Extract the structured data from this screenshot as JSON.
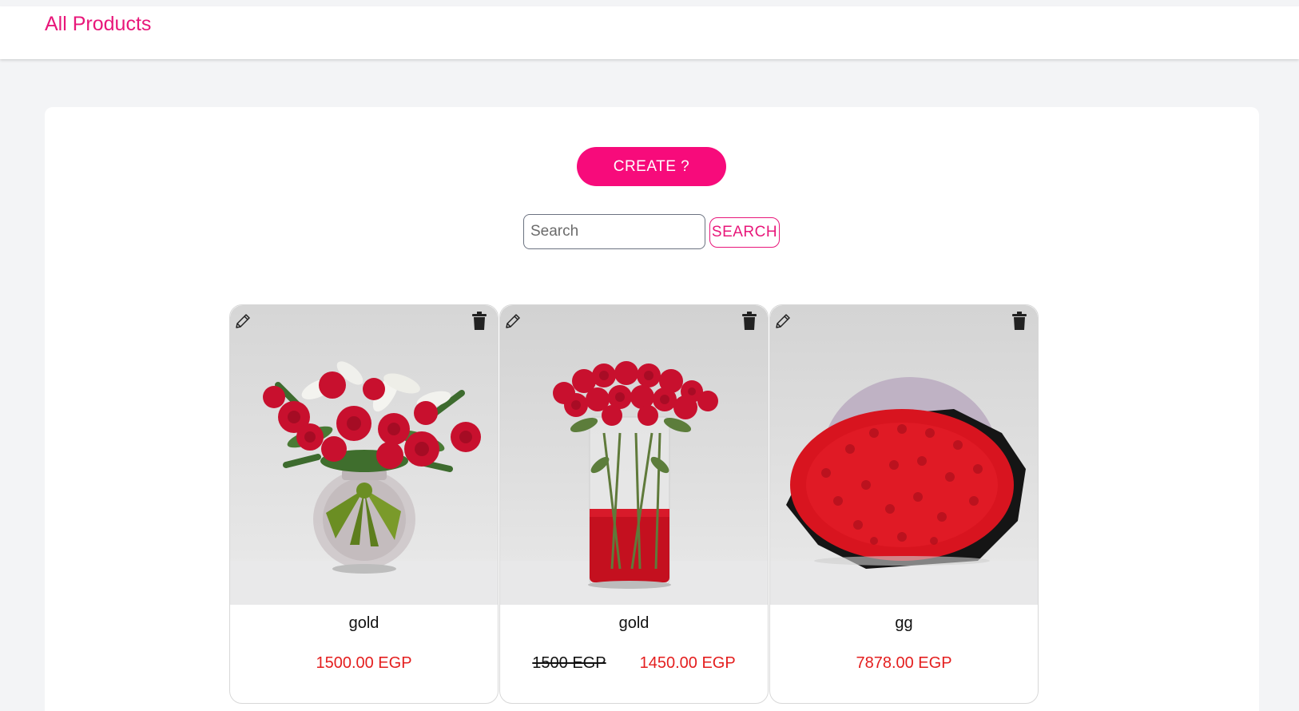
{
  "header": {
    "title": "All Products"
  },
  "toolbar": {
    "create_label": "CREATE ?",
    "search_placeholder": "Search",
    "search_value": "",
    "search_label": "SEARCH"
  },
  "products": [
    {
      "name": "gold",
      "old_price": "",
      "price": "1500.00 EGP",
      "image": "vase-of-red-roses-and-white-lilies-with-green-bow"
    },
    {
      "name": "gold",
      "old_price": "1500 EGP",
      "price": "1450.00 EGP",
      "image": "red-roses-in-tall-glass-vase-with-red-water"
    },
    {
      "name": "gg",
      "old_price": "",
      "price": "7878.00 EGP",
      "image": "large-red-rose-bouquet-wrapped-in-black-paper"
    }
  ],
  "icons": {
    "edit": "pencil-icon",
    "delete": "trash-icon"
  },
  "colors": {
    "brand_pink": "#f70b7b",
    "title_pink": "#e8177a",
    "price_red": "#e41e1e",
    "page_bg": "#f3f4f6"
  }
}
